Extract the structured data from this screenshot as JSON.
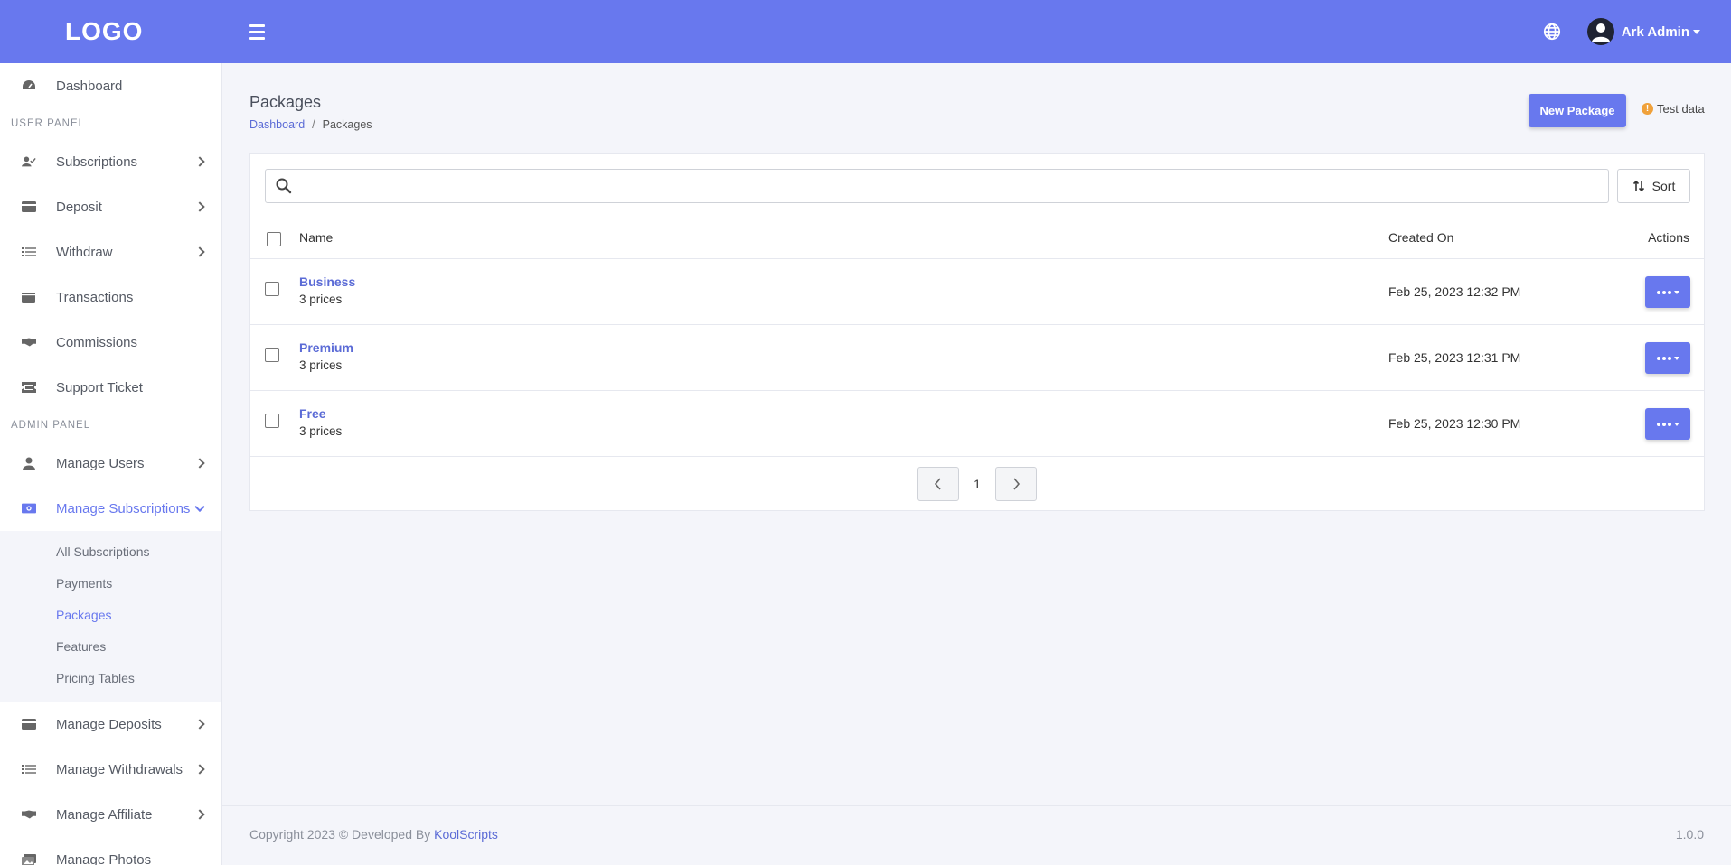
{
  "header": {
    "logo": "LOGO",
    "user_name": "Ark Admin"
  },
  "sidebar": {
    "dashboard": "Dashboard",
    "user_panel_title": "USER PANEL",
    "user_items": [
      {
        "label": "Subscriptions",
        "icon": "user-check-icon"
      },
      {
        "label": "Deposit",
        "icon": "credit-card-icon"
      },
      {
        "label": "Withdraw",
        "icon": "list-icon"
      },
      {
        "label": "Transactions",
        "icon": "wallet-icon"
      },
      {
        "label": "Commissions",
        "icon": "handshake-icon"
      },
      {
        "label": "Support Ticket",
        "icon": "ticket-icon"
      }
    ],
    "admin_panel_title": "ADMIN PANEL",
    "admin_items": [
      {
        "label": "Manage Users",
        "icon": "user-icon"
      },
      {
        "label": "Manage Subscriptions",
        "icon": "money-bill-icon"
      }
    ],
    "submenu": [
      "All Subscriptions",
      "Payments",
      "Packages",
      "Features",
      "Pricing Tables"
    ],
    "admin_items_after": [
      {
        "label": "Manage Deposits",
        "icon": "credit-card-icon"
      },
      {
        "label": "Manage Withdrawals",
        "icon": "list-icon"
      },
      {
        "label": "Manage Affiliate",
        "icon": "handshake-icon"
      },
      {
        "label": "Manage Photos",
        "icon": "images-icon"
      }
    ]
  },
  "page": {
    "title": "Packages",
    "breadcrumb_home": "Dashboard",
    "breadcrumb_sep": "/",
    "breadcrumb_current": "Packages",
    "new_button": "New Package",
    "test_data": "Test data",
    "sort_label": "Sort",
    "search_placeholder": ""
  },
  "table": {
    "columns": [
      "Name",
      "Created On",
      "Actions"
    ],
    "rows": [
      {
        "name": "Business",
        "prices": "3 prices",
        "created": "Feb 25, 2023 12:32 PM"
      },
      {
        "name": "Premium",
        "prices": "3 prices",
        "created": "Feb 25, 2023 12:31 PM"
      },
      {
        "name": "Free",
        "prices": "3 prices",
        "created": "Feb 25, 2023 12:30 PM"
      }
    ]
  },
  "pagination": {
    "current_page": "1"
  },
  "footer": {
    "copyright": "Copyright 2023 © Developed By ",
    "developer": "KoolScripts",
    "version": "1.0.0"
  },
  "colors": {
    "accent": "#6878ee",
    "link": "#5b6bd6",
    "warning": "#f0a13a"
  }
}
